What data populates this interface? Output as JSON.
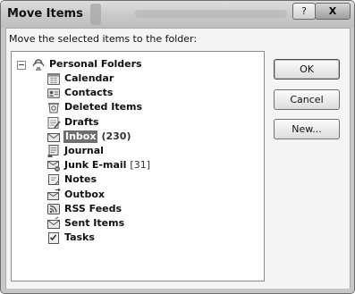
{
  "dialog": {
    "title": "Move Items",
    "help_label": "?",
    "close_label": "X"
  },
  "instruction": "Move the selected items to the folder:",
  "tree": {
    "root": {
      "label": "Personal Folders",
      "icon": "personal-folders-icon"
    },
    "folders": [
      {
        "label": "Calendar",
        "icon": "calendar-icon",
        "count": ""
      },
      {
        "label": "Contacts",
        "icon": "contacts-icon",
        "count": ""
      },
      {
        "label": "Deleted Items",
        "icon": "deleted-items-icon",
        "count": ""
      },
      {
        "label": "Drafts",
        "icon": "drafts-icon",
        "count": ""
      },
      {
        "label": "Inbox",
        "icon": "inbox-icon",
        "count": "(230)",
        "selected": true
      },
      {
        "label": "Journal",
        "icon": "journal-icon",
        "count": ""
      },
      {
        "label": "Junk E-mail",
        "icon": "junk-email-icon",
        "count": "[31]"
      },
      {
        "label": "Notes",
        "icon": "notes-icon",
        "count": ""
      },
      {
        "label": "Outbox",
        "icon": "outbox-icon",
        "count": ""
      },
      {
        "label": "RSS Feeds",
        "icon": "rss-feeds-icon",
        "count": ""
      },
      {
        "label": "Sent Items",
        "icon": "sent-items-icon",
        "count": ""
      },
      {
        "label": "Tasks",
        "icon": "tasks-icon",
        "count": ""
      }
    ]
  },
  "buttons": {
    "ok": "OK",
    "cancel": "Cancel",
    "new": "New..."
  },
  "colors": {
    "selection": "#6f6f6f",
    "window_frame": "#c8c8c8"
  }
}
